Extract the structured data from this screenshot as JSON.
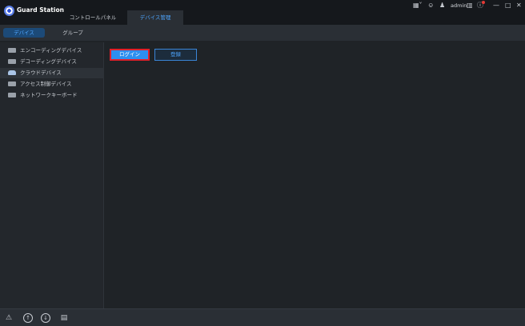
{
  "app": {
    "title": "Guard Station"
  },
  "top_tabs": [
    {
      "label": "コントロールパネル"
    },
    {
      "label": "デバイス管理"
    }
  ],
  "titlebar": {
    "user": "admin",
    "icons": [
      "grid-menu-icon",
      "shirt-icon",
      "users-icon",
      "lock-icon",
      "help-icon",
      "minimize-icon",
      "maximize-icon",
      "close-icon"
    ]
  },
  "sub_tabs": [
    {
      "label": "デバイス"
    },
    {
      "label": "グループ"
    }
  ],
  "sidebar": {
    "items": [
      {
        "label": "エンコーディングデバイス"
      },
      {
        "label": "デコーディングデバイス"
      },
      {
        "label": "クラウドデバイス"
      },
      {
        "label": "アクセス制御デバイス"
      },
      {
        "label": "ネットワークキーボード"
      }
    ]
  },
  "main": {
    "login_label": "ログイン",
    "register_label": "登録"
  },
  "bottombar": {
    "icons": [
      "warning-icon",
      "upload-icon",
      "download-icon",
      "task-list-icon"
    ]
  },
  "colors": {
    "accent": "#2d8ff0",
    "highlight_border": "#e0202a",
    "background": "#1f2327",
    "titlebar": "#15181c"
  }
}
